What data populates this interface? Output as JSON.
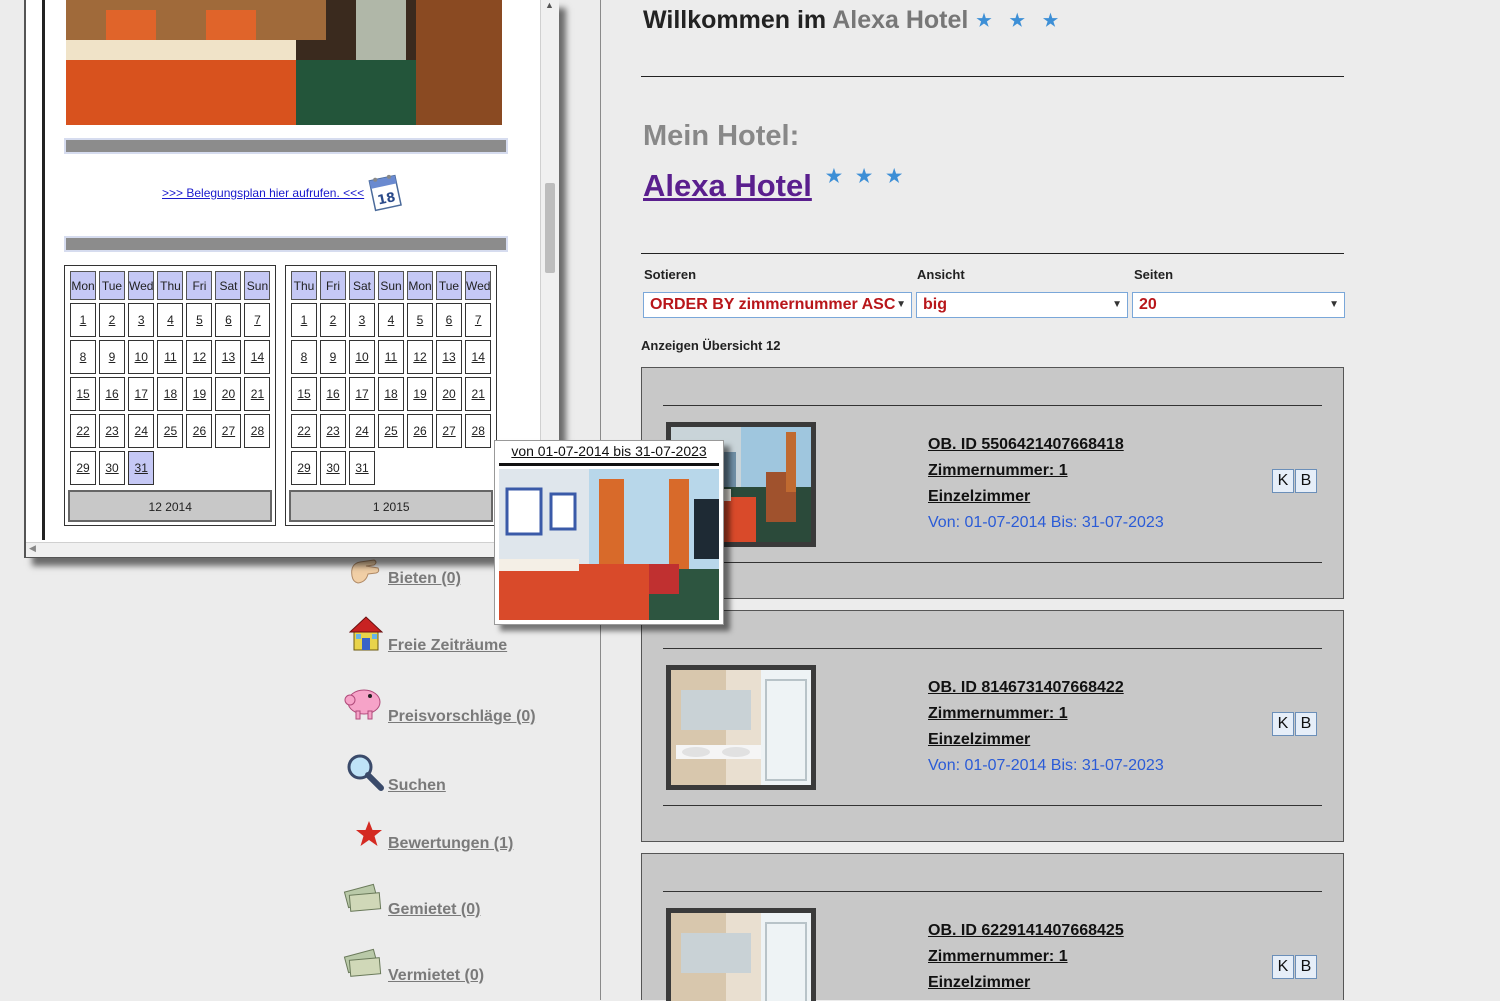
{
  "header": {
    "welcome_prefix": "Willkommen im",
    "hotel_name": "Alexa Hotel",
    "star_icon": "★"
  },
  "mein_hotel": {
    "label": "Mein Hotel:",
    "name": "Alexa Hotel"
  },
  "filters": {
    "sort_label": "Sotieren",
    "sort_value": "ORDER BY zimmernummer ASC",
    "view_label": "Ansicht",
    "view_value": "big",
    "pages_label": "Seiten",
    "pages_value": "20"
  },
  "overview_text": "Anzeigen Übersicht 12",
  "rooms": [
    {
      "id": "OB. ID 5506421407668418",
      "room_no": "Zimmernummer: 1",
      "type": "Einzelzimmer",
      "dates": "Von: 01-07-2014 Bis: 31-07-2023",
      "btn_k": "K",
      "btn_b": "B"
    },
    {
      "id": "OB. ID 8146731407668422",
      "room_no": "Zimmernummer: 1",
      "type": "Einzelzimmer",
      "dates": "Von: 01-07-2014 Bis: 31-07-2023",
      "btn_k": "K",
      "btn_b": "B"
    },
    {
      "id": "OB. ID 6229141407668425",
      "room_no": "Zimmernummer: 1",
      "type": "Einzelzimmer",
      "btn_k": "K",
      "btn_b": "B"
    }
  ],
  "nav": {
    "bieten": "Bieten (0)",
    "freie": "Freie Zeiträume",
    "preis": "Preisvorschläge (0)",
    "suchen": "Suchen",
    "bewertungen": "Bewertungen (1)",
    "gemietet": "Gemietet (0)",
    "vermietet": "Vermietet (0)"
  },
  "popup": {
    "plan_link": ">>> Belegungsplan hier aufrufen. <<<",
    "cal_icon_text": "18",
    "cal1": {
      "headers": [
        "Mon",
        "Tue",
        "Wed",
        "Thu",
        "Fri",
        "Sat",
        "Sun"
      ],
      "footer": "12 2014",
      "rows": [
        [
          "1",
          "2",
          "3",
          "4",
          "5",
          "6",
          "7"
        ],
        [
          "8",
          "9",
          "10",
          "11",
          "12",
          "13",
          "14"
        ],
        [
          "15",
          "16",
          "17",
          "18",
          "19",
          "20",
          "21"
        ],
        [
          "22",
          "23",
          "24",
          "25",
          "26",
          "27",
          "28"
        ],
        [
          "29",
          "30",
          "31",
          "",
          "",
          "",
          ""
        ]
      ],
      "today": "31"
    },
    "cal2": {
      "headers": [
        "Thu",
        "Fri",
        "Sat",
        "Sun",
        "Mon",
        "Tue",
        "Wed"
      ],
      "footer": "1 2015",
      "rows": [
        [
          "1",
          "2",
          "3",
          "4",
          "5",
          "6",
          "7"
        ],
        [
          "8",
          "9",
          "10",
          "11",
          "12",
          "13",
          "14"
        ],
        [
          "15",
          "16",
          "17",
          "18",
          "19",
          "20",
          "21"
        ],
        [
          "22",
          "23",
          "24",
          "25",
          "26",
          "27",
          "28"
        ],
        [
          "29",
          "30",
          "31",
          "",
          "",
          "",
          ""
        ]
      ],
      "today": ""
    }
  },
  "preview": {
    "title": "von 01-07-2014 bis 31-07-2023"
  }
}
